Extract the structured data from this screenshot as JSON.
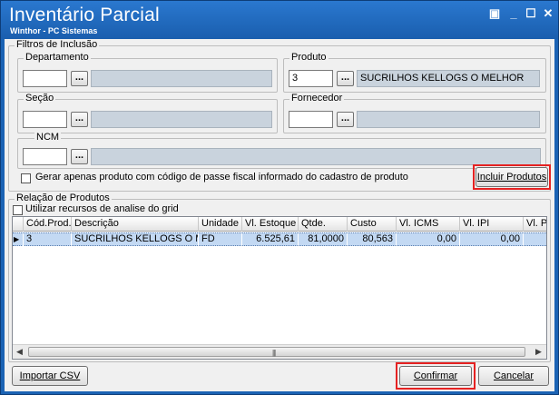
{
  "window": {
    "title": "Inventário Parcial",
    "subtitle": "Winthor - PC Sistemas",
    "icon_restore": "▣",
    "icon_minimize": "_",
    "icon_maximize": "☐",
    "icon_close": "✕"
  },
  "filtros": {
    "legend": "Filtros de Inclusão",
    "departamento": {
      "label": "Departamento",
      "value": "",
      "description": ""
    },
    "produto": {
      "label": "Produto",
      "value": "3",
      "description": "SUCRILHOS KELLOGS O MELHOR"
    },
    "secao": {
      "label": "Seção",
      "value": "",
      "description": ""
    },
    "fornecedor": {
      "label": "Fornecedor",
      "value": "",
      "description": ""
    },
    "ncm": {
      "label": "NCM",
      "value": "",
      "description": ""
    },
    "lookup_label": "...",
    "checkbox_label": "Gerar apenas produto com código de passe fiscal informado do cadastro de produto",
    "incluir_button": "Incluir Produtos"
  },
  "relacao": {
    "legend": "Relação de Produtos",
    "checkbox_label": "Utilizar recursos de analise do grid",
    "columns": [
      "Cód.Prod.",
      "Descrição",
      "Unidade",
      "Vl. Estoque",
      "Qtde.",
      "Custo",
      "Vl. ICMS",
      "Vl. IPI",
      "Vl. PIS"
    ],
    "row_indicator": "▶",
    "rows": [
      {
        "cod": "3",
        "descricao": "SUCRILHOS KELLOGS O MELHOR",
        "unidade": "FD",
        "vl_estoque": "6.525,61",
        "qtde": "81,0000",
        "custo": "80,563",
        "vl_icms": "0,00",
        "vl_ipi": "0,00",
        "vl_pis": ""
      }
    ],
    "scroll_left": "◀",
    "scroll_right": "▶",
    "scroll_grip": "|||"
  },
  "footer": {
    "importar_button": "Importar CSV",
    "confirmar_button": "Confirmar",
    "cancelar_button": "Cancelar"
  }
}
